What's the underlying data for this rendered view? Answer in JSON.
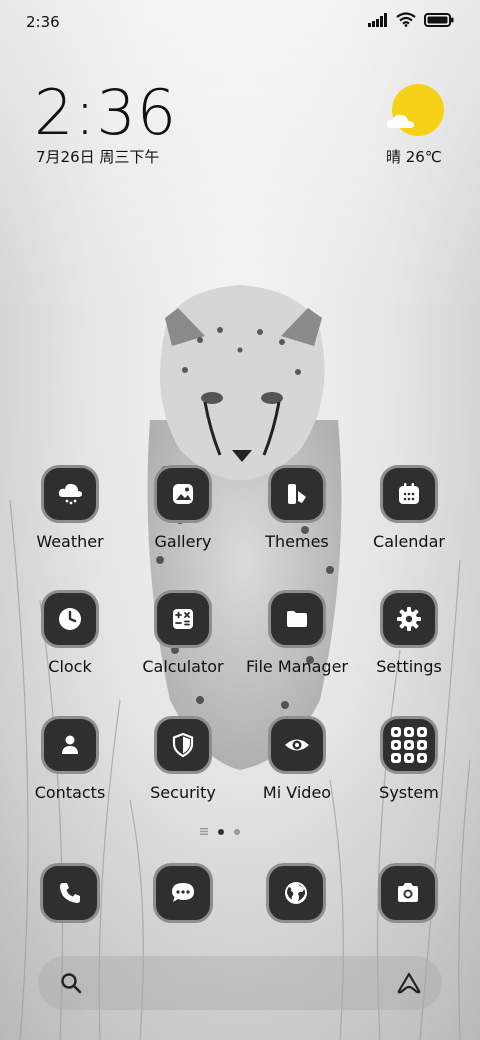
{
  "status_bar": {
    "time": "2:36"
  },
  "clock_widget": {
    "time": "2:36",
    "date": "7月26日 周三下午"
  },
  "weather_widget": {
    "text": "晴 26℃"
  },
  "apps": [
    {
      "label": "Weather",
      "icon": "weather-icon"
    },
    {
      "label": "Gallery",
      "icon": "gallery-icon"
    },
    {
      "label": "Themes",
      "icon": "themes-icon"
    },
    {
      "label": "Calendar",
      "icon": "calendar-icon"
    },
    {
      "label": "Clock",
      "icon": "clock-icon"
    },
    {
      "label": "Calculator",
      "icon": "calculator-icon"
    },
    {
      "label": "File Manager",
      "icon": "folder-icon"
    },
    {
      "label": "Settings",
      "icon": "gear-icon"
    },
    {
      "label": "Contacts",
      "icon": "person-icon"
    },
    {
      "label": "Security",
      "icon": "shield-icon"
    },
    {
      "label": "Mi Video",
      "icon": "eye-icon"
    },
    {
      "label": "System",
      "icon": "folder-grid-icon"
    }
  ],
  "dock": [
    {
      "icon": "phone-icon"
    },
    {
      "icon": "message-icon"
    },
    {
      "icon": "globe-icon"
    },
    {
      "icon": "camera-icon"
    }
  ],
  "colors": {
    "tile": "#2f2f2f",
    "tile_border": "#8e8e8e",
    "sun": "#f7d117"
  }
}
